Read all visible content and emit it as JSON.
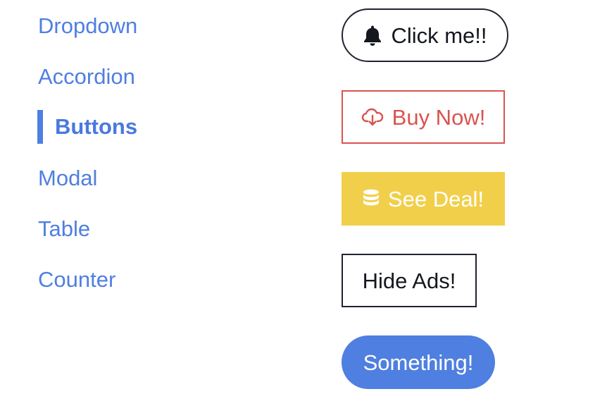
{
  "sidebar": {
    "items": [
      {
        "label": "Dropdown",
        "active": false
      },
      {
        "label": "Accordion",
        "active": false
      },
      {
        "label": "Buttons",
        "active": true
      },
      {
        "label": "Modal",
        "active": false
      },
      {
        "label": "Table",
        "active": false
      },
      {
        "label": "Counter",
        "active": false
      }
    ]
  },
  "buttons": {
    "click_me": {
      "label": "Click me!!",
      "icon": "bell-icon"
    },
    "buy_now": {
      "label": "Buy Now!",
      "icon": "cloud-download-icon"
    },
    "see_deal": {
      "label": "See Deal!",
      "icon": "database-icon"
    },
    "hide_ads": {
      "label": "Hide Ads!"
    },
    "something": {
      "label": "Something!"
    }
  },
  "colors": {
    "link_blue": "#4f7fe0",
    "danger_red": "#d9534f",
    "warning_yellow": "#f2cf4a",
    "dark_text": "#15181f"
  }
}
